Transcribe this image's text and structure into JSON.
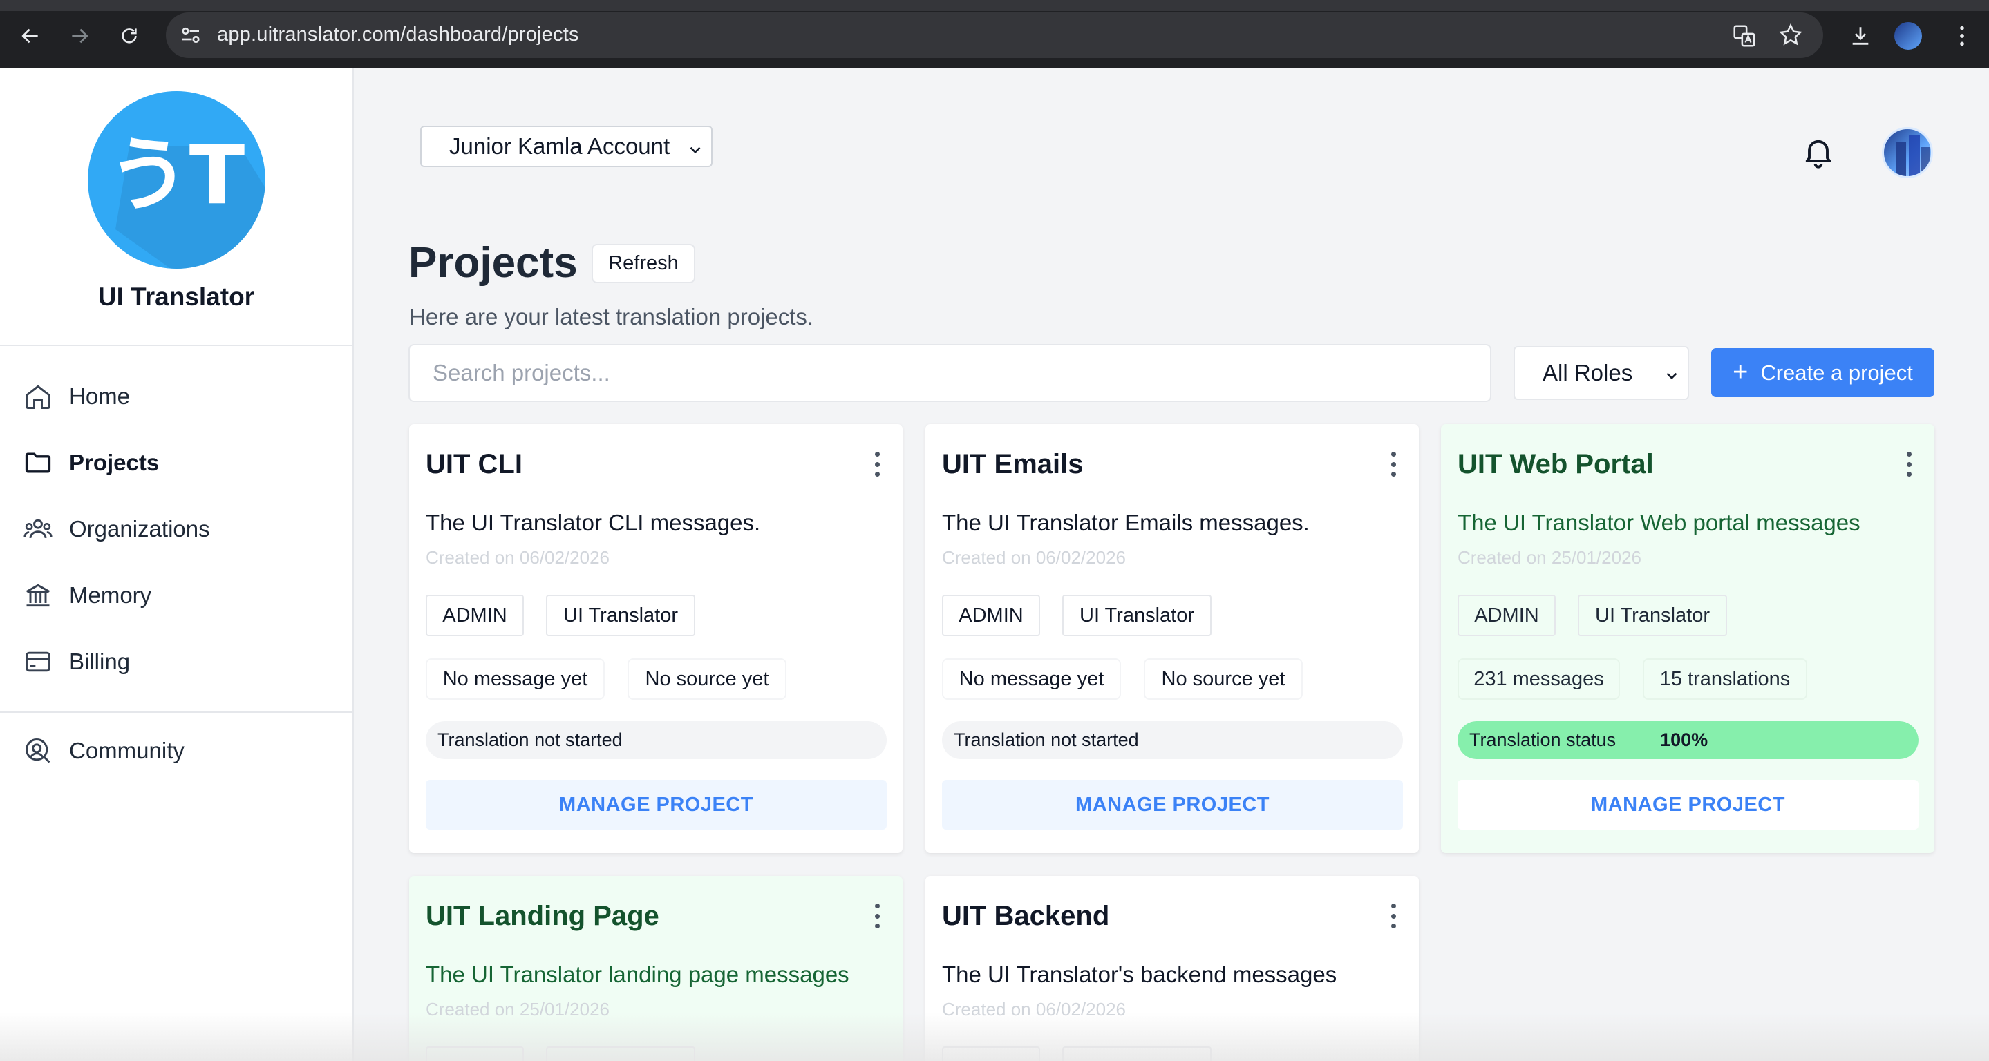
{
  "browser": {
    "url": "app.uitranslator.com/dashboard/projects"
  },
  "sidebar": {
    "brand": "UI Translator",
    "logo_text": "うT",
    "items": [
      {
        "label": "Home",
        "icon": "home-icon"
      },
      {
        "label": "Projects",
        "icon": "folder-icon",
        "active": true
      },
      {
        "label": "Organizations",
        "icon": "users-icon"
      },
      {
        "label": "Memory",
        "icon": "bank-icon"
      },
      {
        "label": "Billing",
        "icon": "credit-card-icon"
      }
    ],
    "community": {
      "label": "Community",
      "icon": "community-icon"
    }
  },
  "header": {
    "account": "Junior Kamla Account"
  },
  "page": {
    "title": "Projects",
    "refresh_label": "Refresh",
    "subtitle": "Here are your latest translation projects.",
    "search_placeholder": "Search projects...",
    "roles_value": "All Roles",
    "create_label": "Create a project",
    "create_symbol": "+"
  },
  "projects": [
    {
      "name": "UIT CLI",
      "description": "The UI Translator CLI messages.",
      "created": "Created on 06/02/2026",
      "role": "ADMIN",
      "org": "UI Translator",
      "messages": "No message yet",
      "sources": "No source yet",
      "status_label": "Translation not started",
      "manage_label": "MANAGE PROJECT"
    },
    {
      "name": "UIT Emails",
      "description": "The UI Translator Emails messages.",
      "created": "Created on 06/02/2026",
      "role": "ADMIN",
      "org": "UI Translator",
      "messages": "No message yet",
      "sources": "No source yet",
      "status_label": "Translation not started",
      "manage_label": "MANAGE PROJECT"
    },
    {
      "name": "UIT Web Portal",
      "description": "The UI Translator Web portal messages",
      "created": "Created on 25/01/2026",
      "role": "ADMIN",
      "org": "UI Translator",
      "messages": "231 messages",
      "sources": "15 translations",
      "status_label": "Translation status",
      "status_percent": "100%",
      "status_fraction": 1.0,
      "manage_label": "MANAGE PROJECT"
    },
    {
      "name": "UIT Landing Page",
      "description": "The UI Translator landing page messages",
      "created": "Created on 25/01/2026"
    },
    {
      "name": "UIT Backend",
      "description": "The UI Translator's backend messages",
      "created": "Created on 06/02/2026"
    }
  ],
  "colors": {
    "accent": "#3b82f6",
    "complete_green": "#86efac",
    "complete_card_bg": "#f0fdf4",
    "complete_title": "#14532d"
  }
}
